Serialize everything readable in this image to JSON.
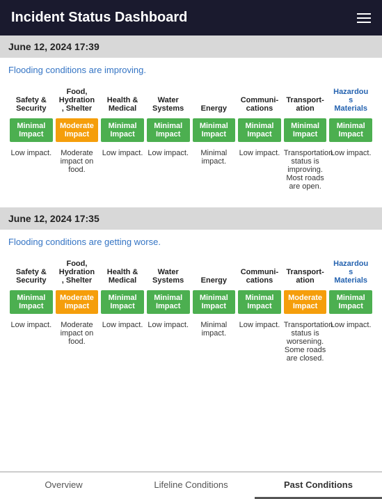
{
  "header": {
    "title": "Incident Status Dashboard",
    "menu_icon": "hamburger"
  },
  "tabs": [
    {
      "id": "overview",
      "label": "Overview",
      "active": false
    },
    {
      "id": "lifeline",
      "label": "Lifeline Conditions",
      "active": false
    },
    {
      "id": "past",
      "label": "Past Conditions",
      "active": true
    }
  ],
  "sections": [
    {
      "id": "section1",
      "date": "June 12, 2024 17:39",
      "flooding_text": "Flooding conditions are improving.",
      "columns": [
        {
          "label": "Safety &\nSecurity",
          "blue": false
        },
        {
          "label": "Food,\nHydration\n, Shelter",
          "blue": false
        },
        {
          "label": "Health &\nMedical",
          "blue": false
        },
        {
          "label": "Water\nSystems",
          "blue": false
        },
        {
          "label": "Energy",
          "blue": false
        },
        {
          "label": "Communi-\ncations",
          "blue": false
        },
        {
          "label": "Transport-\nation",
          "blue": false
        },
        {
          "label": "Hazardou\ns\nMaterials",
          "blue": true
        }
      ],
      "badges": [
        {
          "label": "Minimal\nImpact",
          "type": "green"
        },
        {
          "label": "Moderate\nImpact",
          "type": "orange"
        },
        {
          "label": "Minimal\nImpact",
          "type": "green"
        },
        {
          "label": "Minimal\nImpact",
          "type": "green"
        },
        {
          "label": "Minimal\nImpact",
          "type": "green"
        },
        {
          "label": "Minimal\nImpact",
          "type": "green"
        },
        {
          "label": "Minimal\nImpact",
          "type": "green"
        },
        {
          "label": "Minimal\nImpact",
          "type": "green"
        }
      ],
      "descriptions": [
        {
          "text": "Low impact.",
          "blue": false
        },
        {
          "text": "Moderate impact on food.",
          "blue": true
        },
        {
          "text": "Low impact.",
          "blue": false
        },
        {
          "text": "Low impact.",
          "blue": false
        },
        {
          "text": "Minimal impact.",
          "blue": false
        },
        {
          "text": "Low impact.",
          "blue": false
        },
        {
          "text": "Transportation status is improving. Most roads are open.",
          "blue": false
        },
        {
          "text": "Low impact.",
          "blue": false
        }
      ]
    },
    {
      "id": "section2",
      "date": "June 12, 2024 17:35",
      "flooding_text": "Flooding conditions are getting worse.",
      "columns": [
        {
          "label": "Safety &\nSecurity",
          "blue": false
        },
        {
          "label": "Food,\nHydration\n, Shelter",
          "blue": false
        },
        {
          "label": "Health &\nMedical",
          "blue": false
        },
        {
          "label": "Water\nSystems",
          "blue": false
        },
        {
          "label": "Energy",
          "blue": false
        },
        {
          "label": "Communi-\ncations",
          "blue": false
        },
        {
          "label": "Transport-\nation",
          "blue": false
        },
        {
          "label": "Hazardou\ns\nMaterials",
          "blue": true
        }
      ],
      "badges": [
        {
          "label": "Minimal\nImpact",
          "type": "green"
        },
        {
          "label": "Moderate\nImpact",
          "type": "orange"
        },
        {
          "label": "Minimal\nImpact",
          "type": "green"
        },
        {
          "label": "Minimal\nImpact",
          "type": "green"
        },
        {
          "label": "Minimal\nImpact",
          "type": "green"
        },
        {
          "label": "Minimal\nImpact",
          "type": "green"
        },
        {
          "label": "Moderate\nImpact",
          "type": "orange"
        },
        {
          "label": "Minimal\nImpact",
          "type": "green"
        }
      ],
      "descriptions": [
        {
          "text": "Low impact.",
          "blue": false
        },
        {
          "text": "Moderate impact on food.",
          "blue": true
        },
        {
          "text": "Low impact.",
          "blue": false
        },
        {
          "text": "Low impact.",
          "blue": false
        },
        {
          "text": "Minimal impact.",
          "blue": false
        },
        {
          "text": "Low impact.",
          "blue": false
        },
        {
          "text": "Transportation status is worsening. Some roads are closed.",
          "blue": false
        },
        {
          "text": "Low impact.",
          "blue": false
        }
      ]
    }
  ]
}
